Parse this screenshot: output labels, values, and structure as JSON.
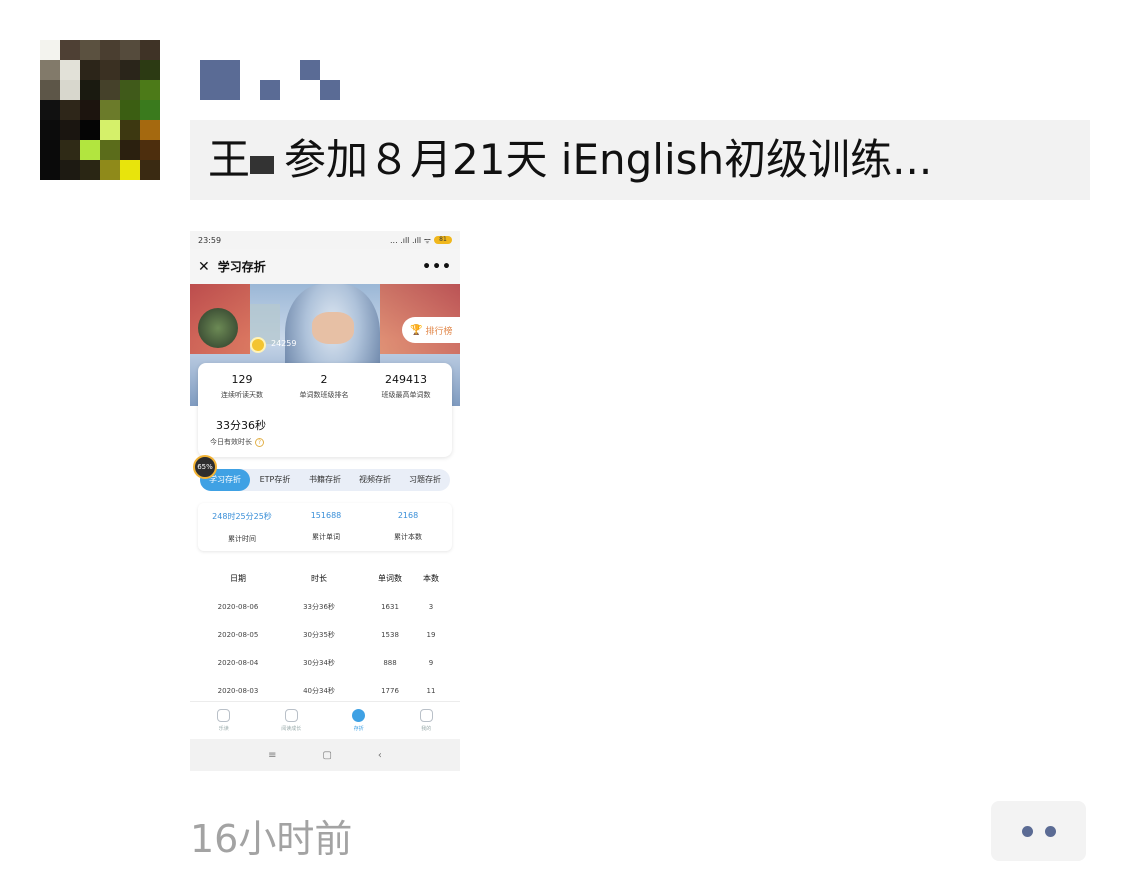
{
  "post": {
    "author_name_pixels": "",
    "text": "参加８月21天 iEnglish初级训练...",
    "name_char": "王",
    "timestamp": "16小时前"
  },
  "screenshot": {
    "status_time": "23:59",
    "status_signal": "... .ıll .ıll ᯤ",
    "battery": "81",
    "nav_close": "✕",
    "nav_title": "学习存折",
    "nav_more": "•••",
    "coins": "24259",
    "rank_label": "排行榜",
    "stats": [
      {
        "value": "129",
        "label": "连续听读天数"
      },
      {
        "value": "2",
        "label": "单词数班级排名"
      },
      {
        "value": "249413",
        "label": "班级最高单词数"
      }
    ],
    "today": {
      "value": "33分36秒",
      "label": "今日有效时长",
      "help": "?"
    },
    "progress": "65%",
    "tabs": [
      "学习存折",
      "ETP存折",
      "书籍存折",
      "视频存折",
      "习题存折"
    ],
    "totals": [
      {
        "value": "248时25分25秒",
        "label": "累计时间"
      },
      {
        "value": "151688",
        "label": "累计单词"
      },
      {
        "value": "2168",
        "label": "累计本数"
      }
    ],
    "table": {
      "headers": [
        "日期",
        "时长",
        "单词数",
        "本数"
      ],
      "rows": [
        [
          "2020-08-06",
          "33分36秒",
          "1631",
          "3"
        ],
        [
          "2020-08-05",
          "30分35秒",
          "1538",
          "19"
        ],
        [
          "2020-08-04",
          "30分34秒",
          "888",
          "9"
        ],
        [
          "2020-08-03",
          "40分34秒",
          "1776",
          "11"
        ]
      ]
    },
    "tabbar": [
      "乐读",
      "阅读成长",
      "存折",
      "我的"
    ],
    "sysbar": [
      "≡",
      "▢",
      "‹"
    ]
  },
  "colors": {
    "accent": "#3fa1e4",
    "name_blue": "#5a6b95",
    "timestamp_gray": "#a3a3a3"
  }
}
